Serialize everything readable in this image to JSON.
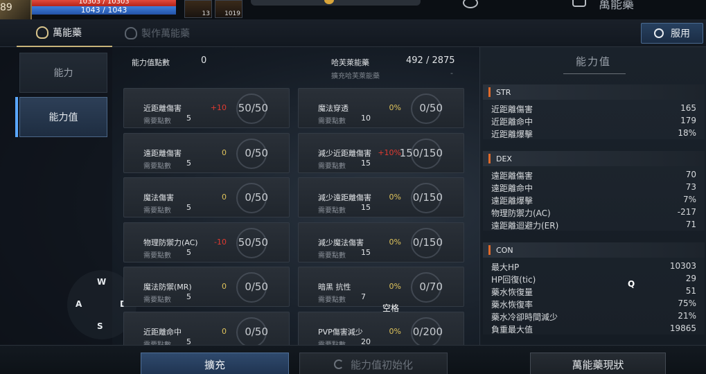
{
  "hud": {
    "level": "89",
    "hp_text": "10303 / 10303",
    "mp_text": "1043 / 1043",
    "slot1_count": "13",
    "slot2_count": "1019",
    "right_text2": "萬能藥"
  },
  "tabs": {
    "potion": "萬能藥",
    "craft": "製作萬能藥",
    "use_button": "服用"
  },
  "sidebar": {
    "ability": "能力",
    "stats": "能力值"
  },
  "joystick": {
    "w": "W",
    "a": "A",
    "s": "S",
    "d": "D"
  },
  "summary": {
    "points_label": "能力值點數",
    "points_value": "0",
    "ref_label": "哈芙萊能藥",
    "ref_value": "492 / 2875",
    "ref_sub_label": "擴充哈芙萊能藥",
    "ref_sub_value": "-"
  },
  "cost_label": "需要點數",
  "cards_left": [
    {
      "name": "近距離傷害",
      "bonus": "+10",
      "bonus_color": "red",
      "level": "50/50",
      "cost": "5"
    },
    {
      "name": "遠距離傷害",
      "bonus": "0",
      "bonus_color": "gold",
      "level": "0/50",
      "cost": "5"
    },
    {
      "name": "魔法傷害",
      "bonus": "0",
      "bonus_color": "gold",
      "level": "0/50",
      "cost": "5"
    },
    {
      "name": "物理防禦力(AC)",
      "bonus": "-10",
      "bonus_color": "red",
      "level": "50/50",
      "cost": "5"
    },
    {
      "name": "魔法防禦(MR)",
      "bonus": "0",
      "bonus_color": "gold",
      "level": "0/50",
      "cost": "5"
    },
    {
      "name": "近距離命中",
      "bonus": "0",
      "bonus_color": "gold",
      "level": "0/50",
      "cost": "5"
    }
  ],
  "cards_right": [
    {
      "name": "魔法穿透",
      "bonus": "0%",
      "bonus_color": "gold",
      "level": "0/50",
      "cost": "10"
    },
    {
      "name": "減少近距離傷害",
      "bonus": "+10%",
      "bonus_color": "red",
      "level": "150/150",
      "cost": "15"
    },
    {
      "name": "減少遠距離傷害",
      "bonus": "0%",
      "bonus_color": "gold",
      "level": "0/150",
      "cost": "15"
    },
    {
      "name": "減少魔法傷害",
      "bonus": "0%",
      "bonus_color": "gold",
      "level": "0/150",
      "cost": "15"
    },
    {
      "name": "暗黑 抗性",
      "bonus": "0%",
      "bonus_color": "gold",
      "level": "0/70",
      "cost": "7"
    },
    {
      "name": "PVP傷害減少",
      "bonus": "0%",
      "bonus_color": "gold",
      "level": "0/200",
      "cost": "20"
    }
  ],
  "stats_panel": {
    "title": "能力值",
    "sections": [
      {
        "head": "STR",
        "rows": [
          {
            "name": "近距離傷害",
            "value": "165"
          },
          {
            "name": "近距離命中",
            "value": "179"
          },
          {
            "name": "近距離爆擊",
            "value": "18%"
          }
        ]
      },
      {
        "head": "DEX",
        "rows": [
          {
            "name": "遠距離傷害",
            "value": "70"
          },
          {
            "name": "遠距離命中",
            "value": "73"
          },
          {
            "name": "遠距離爆擊",
            "value": "7%"
          },
          {
            "name": "物理防禦力(AC)",
            "value": "-217"
          },
          {
            "name": "遠距離迴避力(ER)",
            "value": "71"
          }
        ]
      },
      {
        "head": "CON",
        "rows": [
          {
            "name": "最大HP",
            "value": "10303"
          },
          {
            "name": "HP回復(tic)",
            "value": "29"
          },
          {
            "name": "藥水恢復量",
            "value": "51"
          },
          {
            "name": "藥水恢復率",
            "value": "75%"
          },
          {
            "name": "藥水冷卻時間減少",
            "value": "21%"
          },
          {
            "name": "負重最大值",
            "value": "19865"
          }
        ]
      }
    ]
  },
  "bottom": {
    "expand": "擴充",
    "reset": "能力值初始化",
    "status": "萬能藥現狀"
  },
  "overlay": {
    "q": "Q",
    "space": "空格"
  },
  "colors": {
    "accent_blue": "#5aa7ff",
    "bonus_red": "#e23a30",
    "bonus_gold": "#e0c45c",
    "section_bar": "#e06a2a"
  }
}
